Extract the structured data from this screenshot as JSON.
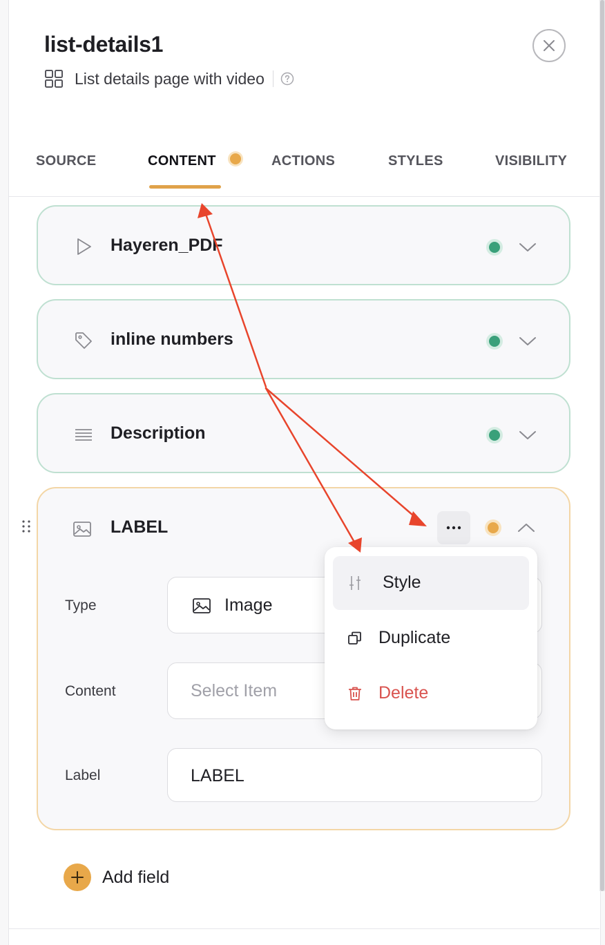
{
  "header": {
    "title": "list-details1",
    "subtitle": "List details page with video"
  },
  "tabs": [
    {
      "label": "SOURCE",
      "active": false
    },
    {
      "label": "CONTENT",
      "active": true,
      "has_indicator": true
    },
    {
      "label": "ACTIONS",
      "active": false
    },
    {
      "label": "STYLES",
      "active": false
    },
    {
      "label": "VISIBILITY",
      "active": false
    }
  ],
  "fields": [
    {
      "title": "Hayeren_PDF",
      "icon": "play-icon",
      "status": "green",
      "expanded": false
    },
    {
      "title": "inline numbers",
      "icon": "tag-icon",
      "status": "green",
      "expanded": false
    },
    {
      "title": "Description",
      "icon": "text-lines-icon",
      "status": "green",
      "expanded": false
    },
    {
      "title": "LABEL",
      "icon": "image-icon",
      "status": "orange",
      "expanded": true
    }
  ],
  "expanded_field": {
    "type_label": "Type",
    "type_value": "Image",
    "content_label": "Content",
    "content_placeholder": "Select Item",
    "label_label": "Label",
    "label_value": "LABEL"
  },
  "context_menu": {
    "items": [
      {
        "label": "Style",
        "icon": "sliders-icon",
        "danger": false
      },
      {
        "label": "Duplicate",
        "icon": "copy-icon",
        "danger": false
      },
      {
        "label": "Delete",
        "icon": "trash-icon",
        "danger": true
      }
    ]
  },
  "add_field_label": "Add field",
  "colors": {
    "accent": "#e8a84a",
    "status_green": "#3aa07a",
    "danger": "#d9534f",
    "annotation_arrow": "#e8452c"
  }
}
